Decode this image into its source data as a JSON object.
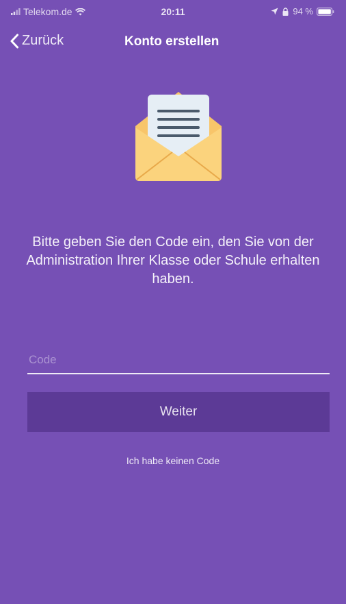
{
  "status_bar": {
    "carrier": "Telekom.de",
    "time": "20:11",
    "battery": "94 %",
    "icons": [
      "signal-icon",
      "wifi-icon",
      "location-icon",
      "lock-rotation-icon",
      "battery-icon"
    ]
  },
  "nav": {
    "back_label": "Zurück",
    "title": "Konto erstellen"
  },
  "hero": {
    "icon": "envelope-open-letter-icon",
    "colors": {
      "envelope": "#f8c56a",
      "letter": "#e6eef5",
      "lines": "#4a5a6b"
    }
  },
  "instruction": "Bitte geben Sie den Code ein, den Sie von der Administration Ihrer Klasse oder Schule erhalten haben.",
  "form": {
    "code_placeholder": "Code",
    "code_value": "",
    "submit_label": "Weiter",
    "no_code_label": "Ich habe keinen Code"
  },
  "colors": {
    "background": "#7650b5",
    "button": "#5c3a96"
  }
}
